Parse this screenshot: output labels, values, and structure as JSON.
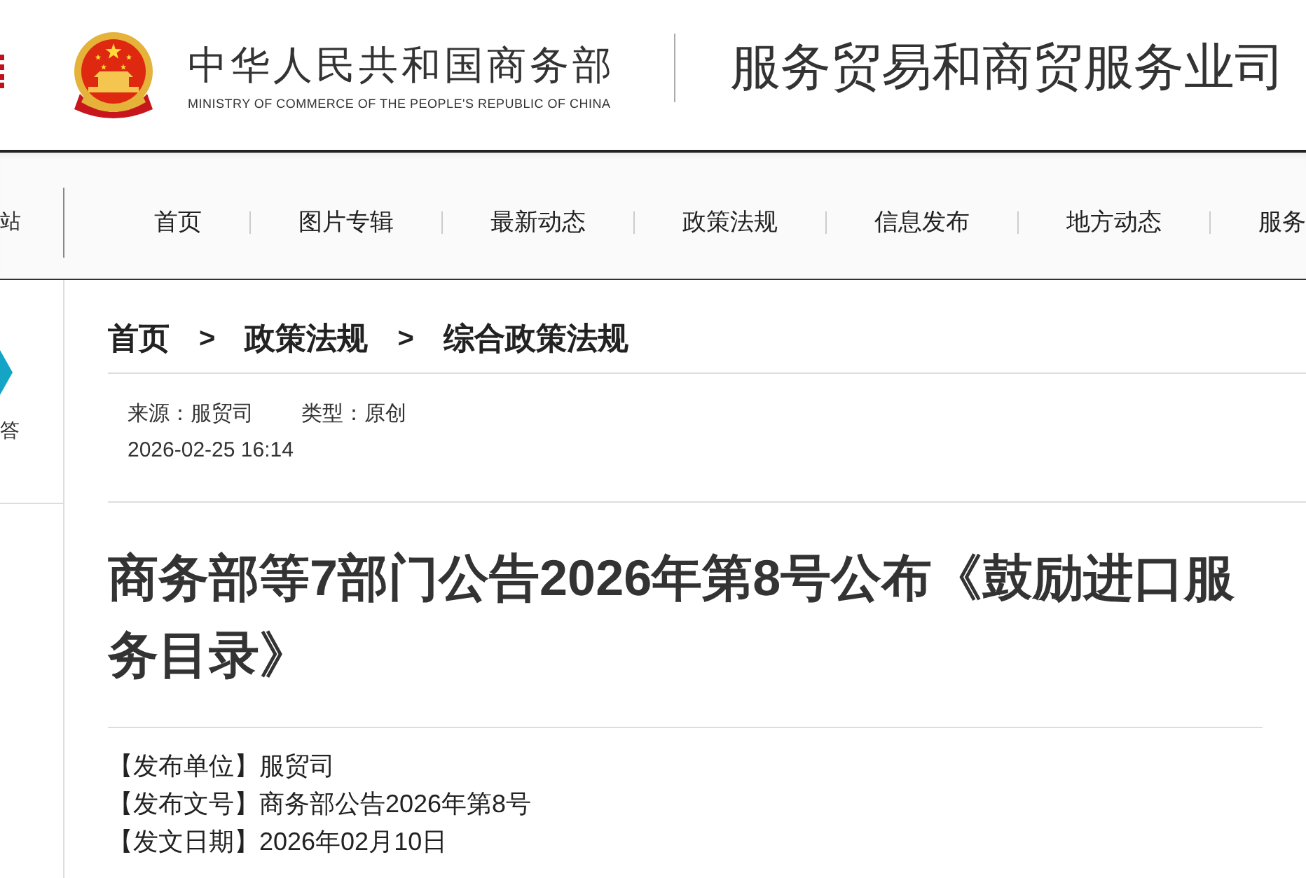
{
  "header": {
    "title": "中华人民共和国商务部",
    "subtitle": "MINISTRY OF COMMERCE OF THE PEOPLE'S REPUBLIC OF CHINA",
    "department": "服务贸易和商贸服务业司"
  },
  "nav": {
    "side_link": "站",
    "items": [
      "首页",
      "图片专辑",
      "最新动态",
      "政策法规",
      "信息发布",
      "地方动态",
      "服务"
    ]
  },
  "sidebar": {
    "item": "答"
  },
  "breadcrumb": [
    {
      "kind": "link",
      "text": "首页"
    },
    {
      "kind": "separator",
      "text": ">"
    },
    {
      "kind": "link",
      "text": "政策法规"
    },
    {
      "kind": "separator",
      "text": ">"
    },
    {
      "kind": "link",
      "text": "综合政策法规"
    }
  ],
  "meta": {
    "source": "来源：服贸司",
    "type": "类型：原创",
    "date": "2026-02-25 16:14"
  },
  "article": {
    "title": "商务部等7部门公告2026年第8号公布《鼓励进口服务目录》",
    "info": [
      "【发布单位】服贸司",
      "【发布文号】商务部公告2026年第8号",
      "【发文日期】2026年02月10日"
    ]
  }
}
